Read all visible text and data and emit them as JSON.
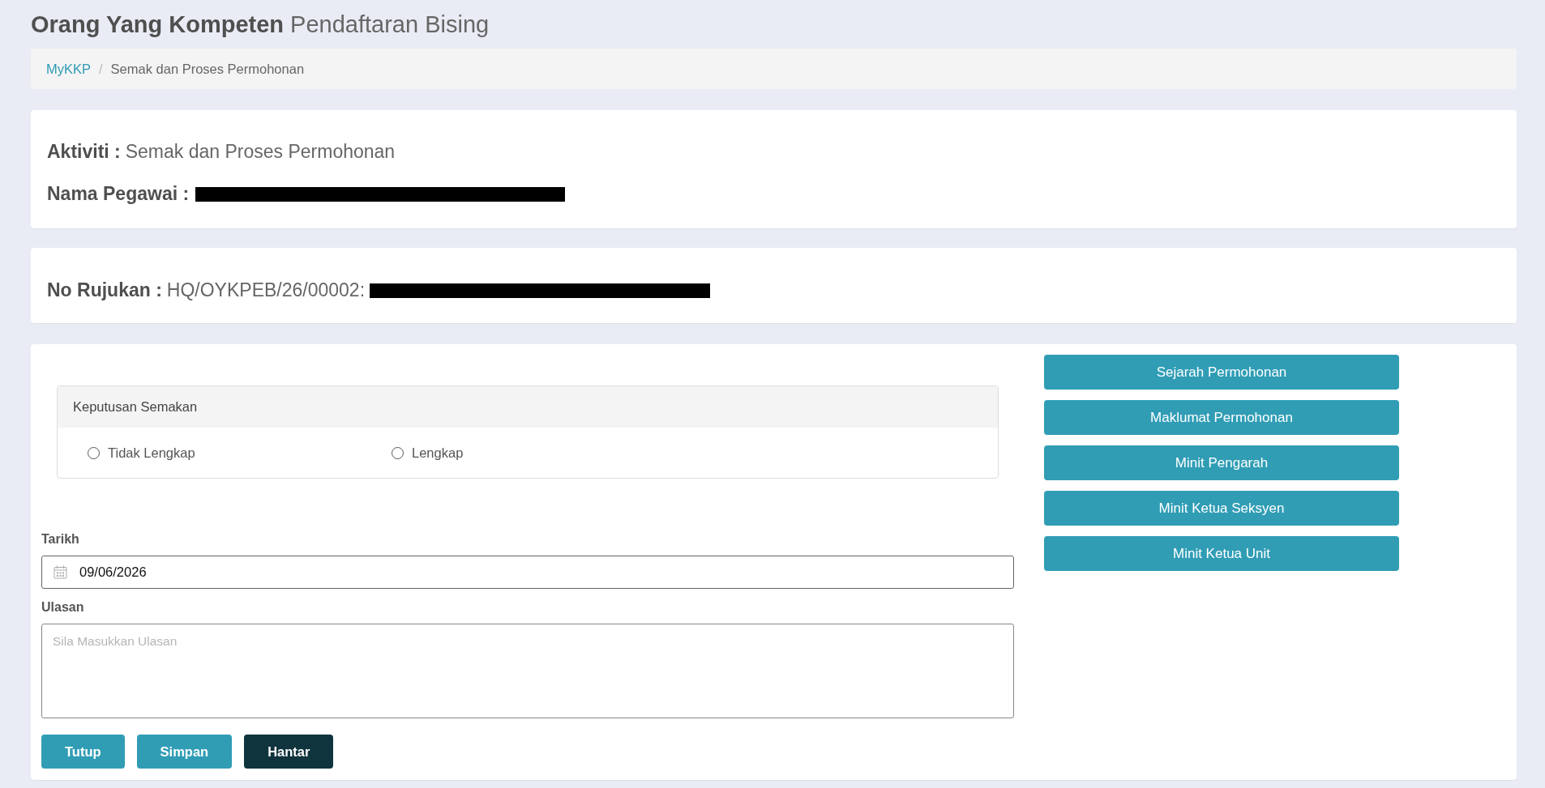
{
  "header": {
    "title": "Orang Yang Kompeten",
    "subtitle": "Pendaftaran Bising"
  },
  "breadcrumb": [
    {
      "label": "MyKKP",
      "kind": "link"
    },
    {
      "label": "/",
      "kind": "divider"
    },
    {
      "label": "Semak dan Proses Permohonan",
      "kind": "current"
    }
  ],
  "activity_card": {
    "fields": [
      {
        "label": "Aktiviti :",
        "value": "Semak dan Proses Permohonan"
      },
      {
        "label": "Nama Pegawai :",
        "redacted": true
      }
    ]
  },
  "reference_card": {
    "fields": [
      {
        "label": "No Rujukan :",
        "value": "HQ/OYKPEB/26/00002:",
        "redacted": true
      }
    ]
  },
  "review_decision": {
    "title": "Keputusan Semakan",
    "options": [
      {
        "label": "Tidak Lengkap",
        "selected": false
      },
      {
        "label": "Lengkap",
        "selected": false
      }
    ]
  },
  "date_field": {
    "label": "Tarikh",
    "value": "09/06/2026"
  },
  "remarks_field": {
    "label": "Ulasan",
    "placeholder": "Sila Masukkan Ulasan"
  },
  "form_buttons": [
    {
      "label": "Tutup",
      "kind": "primary"
    },
    {
      "label": "Simpan",
      "kind": "primary"
    },
    {
      "label": "Hantar",
      "kind": "dark"
    }
  ],
  "side_buttons": [
    "Sejarah Permohonan",
    "Maklumat Permohonan",
    "Minit Pengarah",
    "Minit Ketua Seksyen",
    "Minit Ketua Unit"
  ]
}
